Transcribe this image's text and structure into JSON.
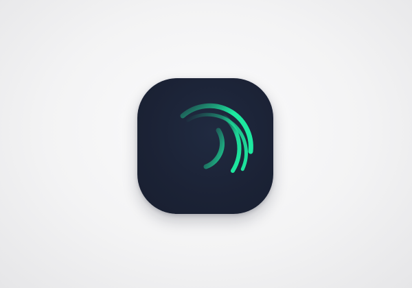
{
  "app_icon": {
    "icon": "alight-motion-logo-icon",
    "background_color": "#1b2235",
    "accent_color": "#1de9a0"
  }
}
